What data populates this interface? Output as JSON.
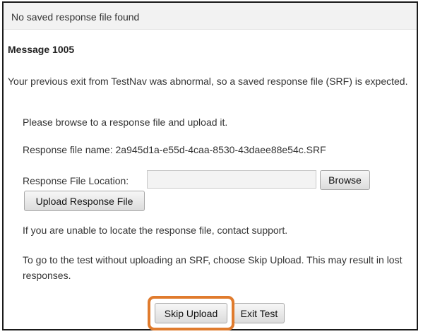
{
  "dialog": {
    "title": "No saved response file found",
    "message_heading": "Message 1005",
    "message_body": "Your previous exit from TestNav was abnormal, so a saved response file (SRF) is expected.",
    "browse_instruction": "Please browse to a response file and upload it.",
    "response_file_name": "Response file name: 2a945d1a-e55d-4caa-8530-43daee88e54c.SRF",
    "file_location_label": "Response File Location:",
    "file_location_value": "",
    "browse_label": "Browse",
    "upload_label": "Upload Response File",
    "support_note": "If you are unable to locate the response file, contact support.",
    "skip_note": "To go to the test without uploading an SRF, choose Skip Upload. This may result in lost responses.",
    "skip_upload_label": "Skip Upload",
    "exit_test_label": "Exit Test"
  },
  "colors": {
    "highlight": "#e07b2d",
    "title_bar": "#f2f2f2",
    "frame_border": "#1a1a1a"
  }
}
